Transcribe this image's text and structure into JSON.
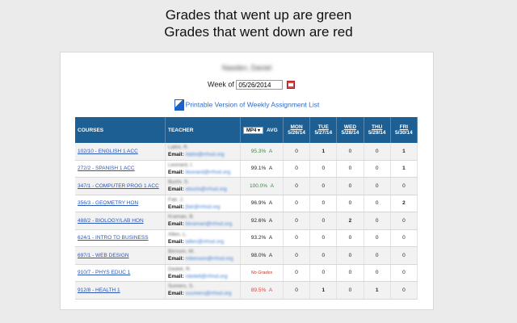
{
  "caption": {
    "line1": "Grades that went up are green",
    "line2": "Grades that went down are red"
  },
  "student_name": "Nasden, Daniel",
  "week": {
    "label": "Week of",
    "value": "05/26/2014"
  },
  "printable_link": "Printable Version of Weekly Assignment List",
  "table": {
    "headers": {
      "courses": "COURSES",
      "teacher": "TEACHER",
      "mp": "MP4",
      "avg": "AVG"
    },
    "days": [
      {
        "name": "MON",
        "date": "5/26/14"
      },
      {
        "name": "TUE",
        "date": "5/27/14"
      },
      {
        "name": "WED",
        "date": "5/28/14"
      },
      {
        "name": "THU",
        "date": "5/29/14"
      },
      {
        "name": "FRI",
        "date": "5/30/14"
      }
    ],
    "rows": [
      {
        "course": "102/10 - ENGLISH 1 ACC",
        "teacher": "Latini, R.",
        "email_label": "Email:",
        "email": "rlatini@rrhsd.org",
        "pct": "95.3%",
        "letter": "A",
        "trend": "up",
        "days": [
          "0",
          "1",
          "0",
          "0",
          "1"
        ]
      },
      {
        "course": "272/2 - SPANISH 1 ACC",
        "teacher": "Leonard, I.",
        "email_label": "Email:",
        "email": "ileonard@rrhsd.org",
        "pct": "99.1%",
        "letter": "A",
        "trend": "neutral",
        "days": [
          "0",
          "0",
          "0",
          "0",
          "1"
        ]
      },
      {
        "course": "347/1 - COMPUTER PROG 1 ACC",
        "teacher": "Buchi, S.",
        "email_label": "Email:",
        "email": "sbuchi@rrhsd.org",
        "pct": "100.0%",
        "letter": "A",
        "trend": "up",
        "days": [
          "0",
          "0",
          "0",
          "0",
          "0"
        ]
      },
      {
        "course": "356/3 - GEOMETRY HON",
        "teacher": "Fair, J.",
        "email_label": "Email:",
        "email": "jfair@rrhsd.org",
        "pct": "96.9%",
        "letter": "A",
        "trend": "neutral",
        "days": [
          "0",
          "0",
          "0",
          "0",
          "2"
        ]
      },
      {
        "course": "488/2 - BIOLOGY/LAB HON",
        "teacher": "Kraman, B.",
        "email_label": "Email:",
        "email": "bkraman@rrhsd.org",
        "pct": "92.6%",
        "letter": "A",
        "trend": "neutral",
        "days": [
          "0",
          "0",
          "2",
          "0",
          "0"
        ]
      },
      {
        "course": "624/1 - INTRO TO BUSINESS",
        "teacher": "Allen, L.",
        "email_label": "Email:",
        "email": "lallen@rrhsd.org",
        "pct": "93.2%",
        "letter": "A",
        "trend": "neutral",
        "days": [
          "0",
          "0",
          "0",
          "0",
          "0"
        ]
      },
      {
        "course": "697/1 - WEB DESIGN",
        "teacher": "Benson, M.",
        "email_label": "Email:",
        "email": "mbenson@rrhsd.org",
        "pct": "98.0%",
        "letter": "A",
        "trend": "neutral",
        "days": [
          "0",
          "0",
          "0",
          "0",
          "0"
        ]
      },
      {
        "course": "910/7 - PHYS EDUC 1",
        "teacher": "Dedell, R.",
        "email_label": "Email:",
        "email": "rdedell@rrhsd.org",
        "pct": "",
        "letter": "",
        "trend": "none",
        "no_grades": "No Grades",
        "days": [
          "0",
          "0",
          "0",
          "0",
          "0"
        ]
      },
      {
        "course": "912/8 - HEALTH 1",
        "teacher": "Sumers, S.",
        "email_label": "Email:",
        "email": "ssumers@rrhsd.org",
        "pct": "89.5%",
        "letter": "A",
        "trend": "down",
        "days": [
          "0",
          "1",
          "0",
          "1",
          "0"
        ]
      }
    ]
  },
  "colors": {
    "header_bg": "#1e5f93",
    "up": "#3f8a3f",
    "down": "#e0443a",
    "link": "#2a56b8"
  }
}
